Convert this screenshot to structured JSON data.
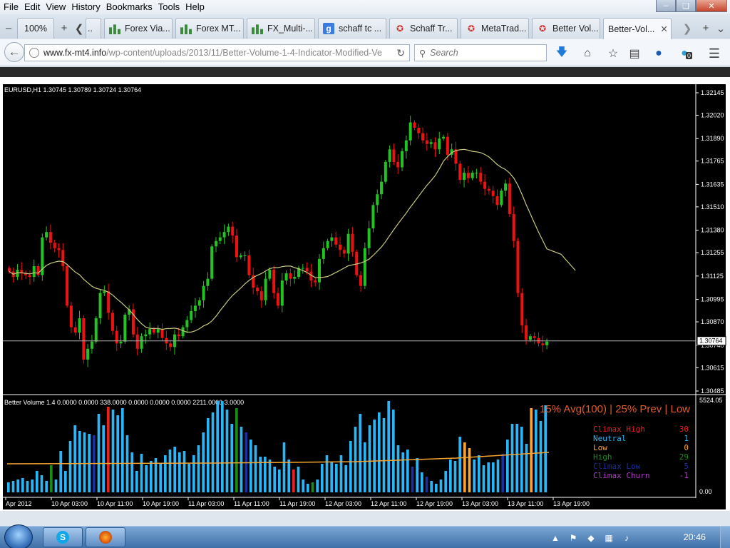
{
  "menu": [
    "File",
    "Edit",
    "View",
    "History",
    "Bookmarks",
    "Tools",
    "Help"
  ],
  "tabs": {
    "zoom": "100%",
    "items": [
      {
        "label": "Forex Via...",
        "icon": "chart"
      },
      {
        "label": "Forex MT...",
        "icon": "chart"
      },
      {
        "label": "FX_Multi-...",
        "icon": "chart"
      },
      {
        "label": "schaff tc ...",
        "icon": "google"
      },
      {
        "label": "Schaff Tr...",
        "icon": "star"
      },
      {
        "label": "MetaTrad...",
        "icon": "star"
      },
      {
        "label": "Better Vol...",
        "icon": "star"
      },
      {
        "label": "Better-Vol...",
        "icon": "none",
        "active": true
      }
    ]
  },
  "nav": {
    "url_host": "www.fx-mt4.info",
    "url_path": "/wp-content/uploads/2013/11/Better-Volume-1-4-Indicator-Modified-Ve",
    "search_placeholder": "Search",
    "addon_badge": "0"
  },
  "taskbar": {
    "clock": "20:46"
  },
  "colors": {
    "bull": "#22c422",
    "bear": "#ee1111",
    "ma": "#c8c880",
    "volblue": "#29b6f6",
    "volorange": "#f7a530"
  },
  "chart_data": [
    {
      "type": "candlestick",
      "title": "EURUSD,H1  1.30745 1.30789 1.30724 1.30764",
      "current_price": "1.30764",
      "y_ticks": [
        "1.32145",
        "1.32020",
        "1.31890",
        "1.31765",
        "1.31635",
        "1.31510",
        "1.31380",
        "1.31255",
        "1.31125",
        "1.30995",
        "1.30870",
        "1.30740",
        "1.30615",
        "1.30485"
      ],
      "ylim": [
        1.30485,
        1.32145
      ],
      "candles_close": [
        1.3115,
        1.3112,
        1.3116,
        1.3114,
        1.3113,
        1.3112,
        1.3118,
        1.3113,
        1.3134,
        1.3137,
        1.3131,
        1.3128,
        1.3127,
        1.3118,
        1.3096,
        1.3084,
        1.3081,
        1.3089,
        1.3066,
        1.3072,
        1.3076,
        1.3089,
        1.3103,
        1.3104,
        1.3092,
        1.3082,
        1.3075,
        1.3076,
        1.3091,
        1.3094,
        1.308,
        1.3072,
        1.3079,
        1.308,
        1.3083,
        1.3081,
        1.3083,
        1.3078,
        1.3075,
        1.3073,
        1.308,
        1.3079,
        1.3084,
        1.3088,
        1.3093,
        1.3096,
        1.3099,
        1.3107,
        1.3111,
        1.3129,
        1.3132,
        1.3134,
        1.3137,
        1.314,
        1.3135,
        1.3123,
        1.3124,
        1.3124,
        1.3113,
        1.3106,
        1.3104,
        1.3099,
        1.3111,
        1.3116,
        1.3103,
        1.3096,
        1.311,
        1.3114,
        1.3111,
        1.3112,
        1.3117,
        1.3117,
        1.3115,
        1.311,
        1.3109,
        1.3122,
        1.3128,
        1.3132,
        1.3134,
        1.313,
        1.3127,
        1.3125,
        1.3136,
        1.3126,
        1.3113,
        1.3107,
        1.3128,
        1.3139,
        1.3152,
        1.3158,
        1.3165,
        1.3176,
        1.3183,
        1.3176,
        1.3173,
        1.3182,
        1.3188,
        1.3198,
        1.3195,
        1.3192,
        1.3188,
        1.3186,
        1.3187,
        1.3183,
        1.3189,
        1.319,
        1.318,
        1.3183,
        1.3175,
        1.3166,
        1.317,
        1.3167,
        1.317,
        1.317,
        1.3165,
        1.3161,
        1.316,
        1.3157,
        1.3152,
        1.316,
        1.3164,
        1.3147,
        1.3132,
        1.3103,
        1.3085,
        1.3077,
        1.3079,
        1.3078,
        1.3075,
        1.3074,
        1.3076
      ],
      "ma_label": "",
      "x_labels": [
        "Apr 2012",
        "10 Apr 03:00",
        "10 Apr 11:00",
        "10 Apr 19:00",
        "11 Apr 03:00",
        "11 Apr 11:00",
        "11 Apr 19:00",
        "12 Apr 03:00",
        "12 Apr 11:00",
        "12 Apr 19:00",
        "13 Apr 03:00",
        "13 Apr 11:00",
        "13 Apr 19:00"
      ]
    },
    {
      "type": "bar",
      "title": "Better Volume 1.4 0.0000 0.0000 338.0000 0.0000 0.0000 0.0000 2211.0000 3.0000",
      "y_max_label": "5524.05",
      "y_min_label": "0.00",
      "headline": "15% Avg(100) | 25% Prev | Low",
      "legend": [
        {
          "name": "Climax High",
          "count": "30",
          "color": "#e82020"
        },
        {
          "name": "Neutral",
          "count": "1",
          "color": "#29b6f6"
        },
        {
          "name": "Low",
          "count": "0",
          "color": "#f7a530"
        },
        {
          "name": "High",
          "count": "29",
          "color": "#1a8a1a"
        },
        {
          "name": "Climax Low",
          "count": "5",
          "color": "#1a2fa0"
        },
        {
          "name": "Climax Churn",
          "count": "-1",
          "color": "#b03cc8"
        }
      ],
      "values": [
        14,
        16,
        18,
        20,
        16,
        18,
        30,
        24,
        16,
        38,
        18,
        58,
        30,
        72,
        94,
        86,
        84,
        82,
        80,
        110,
        94,
        120,
        116,
        108,
        118,
        80,
        56,
        30,
        54,
        38,
        44,
        48,
        40,
        52,
        60,
        64,
        56,
        58,
        40,
        52,
        66,
        84,
        104,
        112,
        128,
        128,
        116,
        96,
        118,
        92,
        84,
        74,
        66,
        50,
        50,
        46,
        36,
        32,
        70,
        46,
        32,
        36,
        18,
        12,
        14,
        18,
        40,
        52,
        42,
        40,
        52,
        38,
        72,
        92,
        110,
        70,
        94,
        102,
        112,
        104,
        128,
        116,
        66,
        56,
        60,
        36,
        48,
        28,
        22,
        16,
        12,
        18,
        30,
        46,
        44,
        78,
        70,
        62,
        46,
        52,
        38,
        42,
        42,
        46,
        54,
        74,
        96,
        96,
        92,
        68,
        118,
        116,
        100,
        122
      ],
      "value_colors": [
        "b",
        "b",
        "b",
        "b",
        "b",
        "b",
        "b",
        "b",
        "b",
        "b",
        "b",
        "b",
        "b",
        "b",
        "b",
        "b",
        "b",
        "b",
        "b",
        "b",
        "b",
        "b",
        "b",
        "n",
        "b",
        "b",
        "b",
        "b",
        "b",
        "b",
        "b",
        "b",
        "b",
        "b",
        "b",
        "b",
        "b",
        "b",
        "b",
        "b",
        "b",
        "b",
        "b",
        "b",
        "b",
        "b",
        "b",
        "b",
        "b",
        "b",
        "b",
        "b",
        "b",
        "b",
        "b",
        "b",
        "b",
        "b",
        "b",
        "b",
        "b",
        "b",
        "b",
        "b",
        "b",
        "b",
        "b",
        "b",
        "b",
        "b",
        "b",
        "b",
        "b",
        "b",
        "b",
        "b",
        "b",
        "b",
        "b",
        "b",
        "b",
        "b",
        "b",
        "b",
        "b",
        "b",
        "b",
        "b",
        "b",
        "b",
        "b",
        "b",
        "b",
        "b",
        "b",
        "b",
        "b",
        "b",
        "b",
        "b",
        "b",
        "b",
        "b",
        "b",
        "b",
        "b",
        "b",
        "b",
        "b",
        "b",
        "b",
        "b",
        "b",
        "b"
      ],
      "ma_level": 42
    }
  ]
}
